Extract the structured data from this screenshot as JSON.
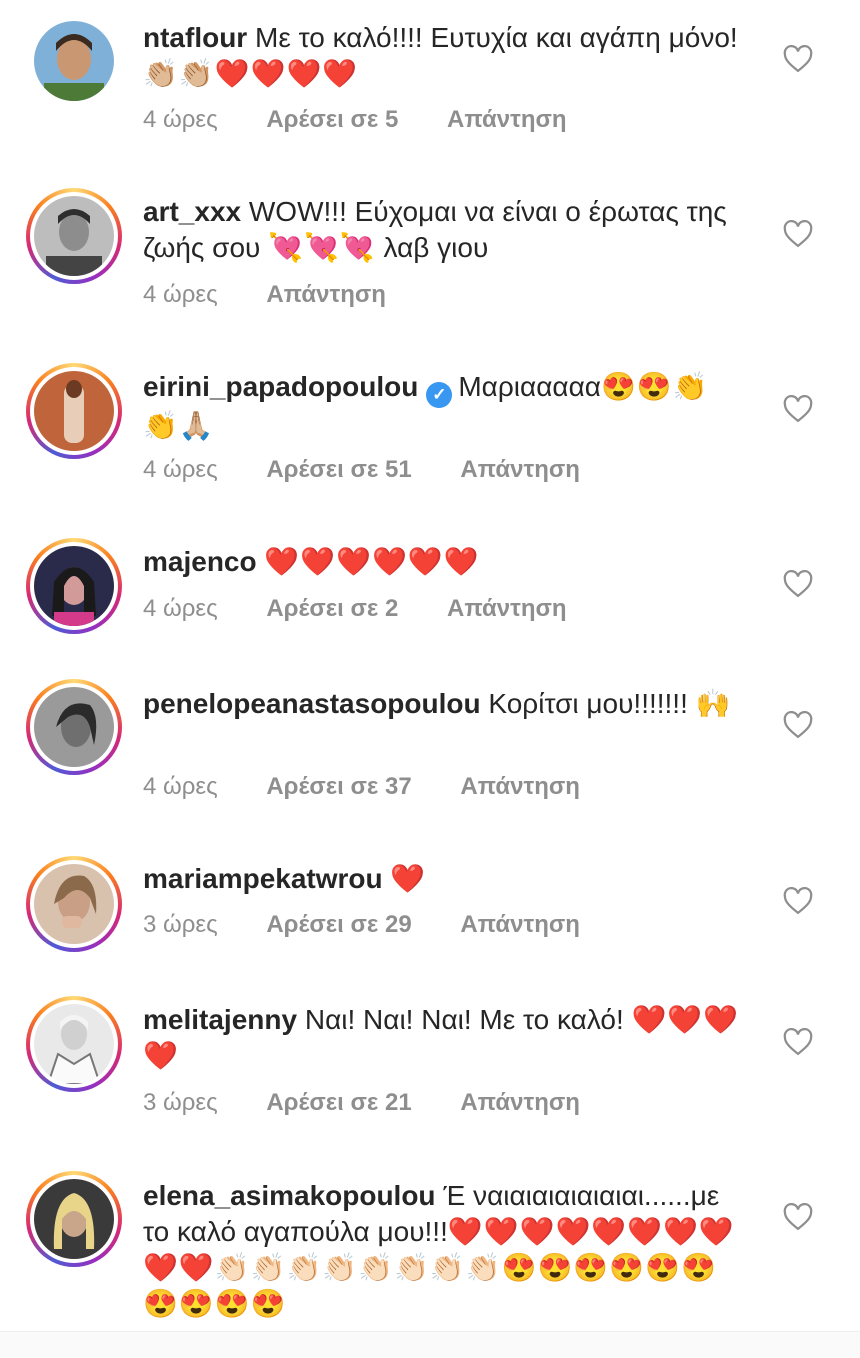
{
  "comments": [
    {
      "username": "ntaflour",
      "text": "Με το καλό!!!! Ευτυχία και αγάπη μόνο!",
      "emojis": "👏🏼👏🏼❤️❤️❤️❤️",
      "time": "4 ώρες",
      "likes": "Αρέσει σε 5",
      "reply": "Απάντηση",
      "verified": false,
      "ring": false,
      "avatar_color": "#6a9a4f",
      "avatar_icon": "avatar-photo"
    },
    {
      "username": "art_xxx",
      "text": "WOW!!! Εύχομαι να είναι ο έρωτας της ζωής σου",
      "emojis": "💘💘💘",
      "text_after": " λαβ γιου",
      "time": "4 ώρες",
      "likes": "",
      "reply": "Απάντηση",
      "verified": false,
      "ring": true,
      "avatar_color": "#9a9a9a",
      "avatar_icon": "avatar-photo"
    },
    {
      "username": "eirini_papadopoulou",
      "text": "Μαριααααα",
      "emojis": "😍😍👏👏🙏🏼",
      "time": "4 ώρες",
      "likes": "Αρέσει σε 51",
      "reply": "Απάντηση",
      "verified": true,
      "ring": true,
      "avatar_color": "#c0653b",
      "avatar_icon": "avatar-photo"
    },
    {
      "username": "majenco",
      "text": "",
      "emojis": "❤️❤️❤️❤️❤️❤️",
      "time": "4 ώρες",
      "likes": "Αρέσει σε 2",
      "reply": "Απάντηση",
      "verified": false,
      "ring": true,
      "avatar_color": "#b04a8a",
      "avatar_icon": "avatar-photo"
    },
    {
      "username": "penelopeanastasopoulou",
      "text": "Κορίτσι μου!!!!!!!",
      "emojis": "🙌",
      "time": "4 ώρες",
      "likes": "Αρέσει σε 37",
      "reply": "Απάντηση",
      "verified": false,
      "ring": true,
      "avatar_color": "#5a5a5a",
      "avatar_icon": "avatar-photo"
    },
    {
      "username": "mariampekatwrou",
      "text": "",
      "emojis": "❤️",
      "time": "3 ώρες",
      "likes": "Αρέσει σε 29",
      "reply": "Απάντηση",
      "verified": false,
      "ring": true,
      "avatar_color": "#c9a48a",
      "avatar_icon": "avatar-photo"
    },
    {
      "username": "melitajenny",
      "text": "Ναι! Ναι! Ναι! Με το καλό!",
      "emojis": "❤️❤️❤️❤️",
      "time": "3 ώρες",
      "likes": "Αρέσει σε 21",
      "reply": "Απάντηση",
      "verified": false,
      "ring": true,
      "avatar_color": "#cfcfcf",
      "avatar_icon": "avatar-photo"
    },
    {
      "username": "elena_asimakopoulou",
      "text": "Έ ναιαιαιαιαιαιαι......με το καλό αγαπούλα μου!!!",
      "emojis": "❤️❤️❤️❤️❤️❤️❤️❤️❤️❤️👏🏻👏🏻👏🏻👏🏻👏🏻👏🏻👏🏻👏🏻😍😍😍😍😍😍😍😍😍😍",
      "time": "",
      "likes": "",
      "reply": "",
      "verified": false,
      "ring": true,
      "avatar_color": "#d8c27a",
      "avatar_icon": "avatar-photo"
    }
  ],
  "icons": {
    "like": "heart-outline-icon",
    "verified": "verified-badge-icon"
  },
  "colors": {
    "text": "#262626",
    "muted": "#8e8e8e",
    "verified": "#3897f0"
  }
}
